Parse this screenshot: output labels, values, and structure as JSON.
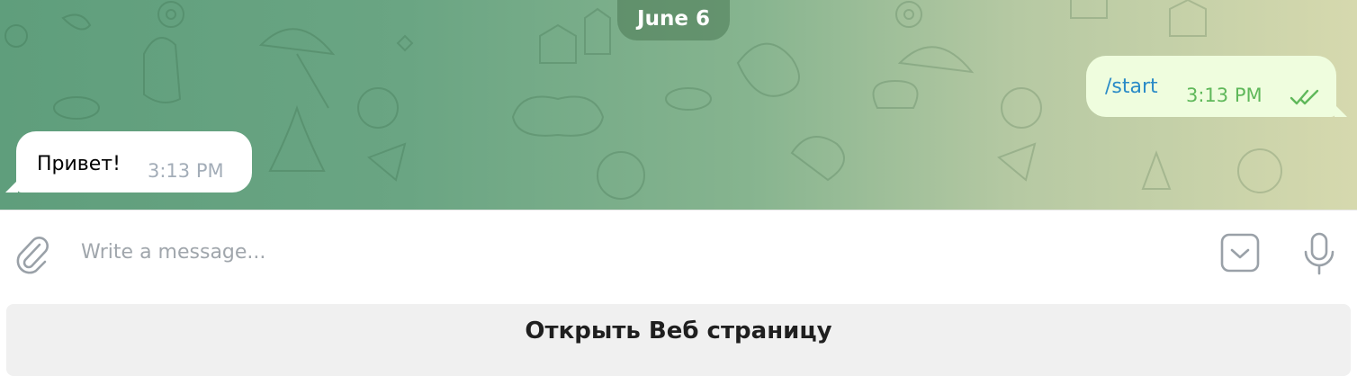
{
  "chat": {
    "date_label": "June 6",
    "messages": [
      {
        "direction": "outgoing",
        "text": "/start",
        "time": "3:13 PM",
        "status": "read"
      },
      {
        "direction": "incoming",
        "text": "Привет!",
        "time": "3:13 PM"
      }
    ]
  },
  "composer": {
    "placeholder": "Write a message...",
    "attach_icon": "paperclip-icon",
    "keyboard_icon": "bot-keyboard-icon",
    "mic_icon": "microphone-icon"
  },
  "reply_keyboard": {
    "button_label": "Открыть Веб страницу"
  },
  "colors": {
    "outgoing_bubble": "#effdde",
    "incoming_bubble": "#ffffff",
    "command_link": "#2a8bc7",
    "outgoing_time": "#5fb85a",
    "incoming_time": "#a3adb8",
    "icon_gray": "#9aa1a8"
  }
}
